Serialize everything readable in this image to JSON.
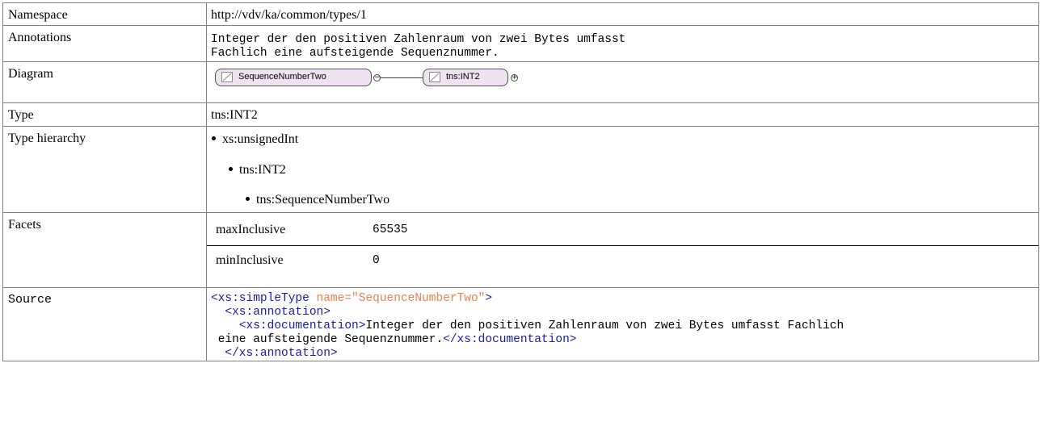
{
  "rows": {
    "namespace": {
      "label": "Namespace",
      "value": "http://vdv/ka/common/types/1"
    },
    "annotations": {
      "label": "Annotations",
      "lines": [
        "Integer der den positiven Zahlenraum von zwei Bytes umfasst",
        "Fachlich eine aufsteigende Sequenznummer."
      ]
    },
    "diagram": {
      "label": "Diagram",
      "element": "SequenceNumberTwo",
      "type": "tns:INT2"
    },
    "type": {
      "label": "Type",
      "value": "tns:INT2"
    },
    "hierarchy": {
      "label": "Type hierarchy",
      "items": [
        "xs:unsignedInt",
        "tns:INT2",
        "tns:SequenceNumberTwo"
      ]
    },
    "facets": {
      "label": "Facets",
      "items": [
        {
          "name": "maxInclusive",
          "value": "65535"
        },
        {
          "name": "minInclusive",
          "value": "0"
        }
      ]
    },
    "source": {
      "label": "Source",
      "line1_tag": "<xs:simpleType",
      "line1_attr": " name=",
      "line1_val": "\"SequenceNumberTwo\"",
      "line1_end": ">",
      "line2": "<xs:annotation>",
      "line3_open": "<xs:documentation>",
      "line3_text": "Integer der den positiven Zahlenraum von zwei Bytes umfasst Fachlich",
      "line4_text": "eine aufsteigende Sequenznummer.",
      "line4_close": "</xs:documentation>",
      "line5": "</xs:annotation>"
    }
  },
  "colors": {
    "tag": "#1a1aa6",
    "attr": "#e8834f",
    "pill_fill": "#efe2f1",
    "border": "#7f7f7f"
  }
}
